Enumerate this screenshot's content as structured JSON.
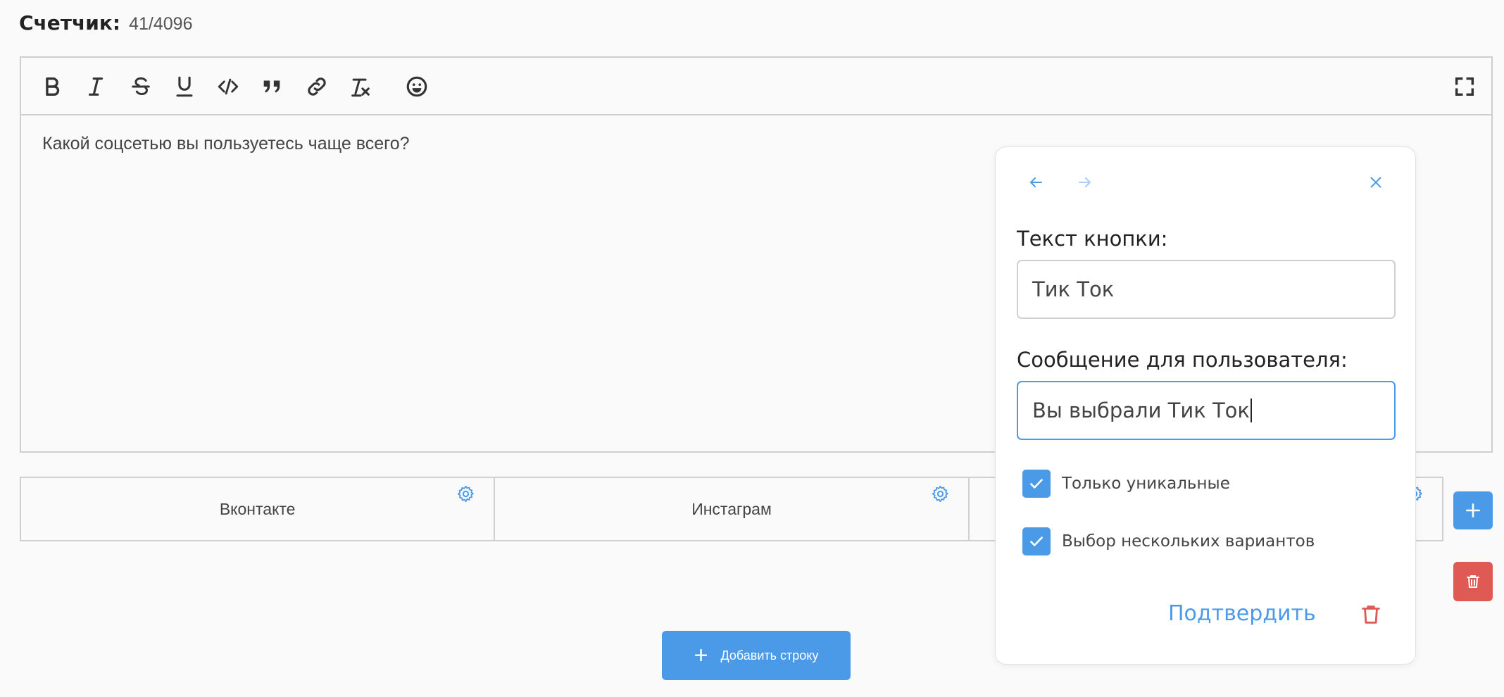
{
  "counter": {
    "label": "Счетчик:",
    "value": "41/4096"
  },
  "toolbar": {
    "icons": [
      "bold-icon",
      "italic-icon",
      "strikethrough-icon",
      "underline-icon",
      "code-icon",
      "quote-icon",
      "link-icon",
      "clear-format-icon",
      "emoji-icon",
      "fullscreen-icon"
    ]
  },
  "editor": {
    "text": "Какой соцсетью вы пользуетесь чаще всего?"
  },
  "buttons_row": {
    "items": [
      {
        "label": "Вконтакте"
      },
      {
        "label": "Инстаграм"
      },
      {
        "label": ""
      }
    ]
  },
  "add_row": {
    "label": "Добавить строку"
  },
  "popup": {
    "button_text_label": "Текст кнопки:",
    "button_text_value": "Тик Ток",
    "message_label": "Сообщение для пользователя:",
    "message_value": "Вы выбрали Тик Ток",
    "checkboxes": [
      {
        "label": "Только уникальные",
        "checked": true
      },
      {
        "label": "Выбор нескольких вариантов",
        "checked": true
      }
    ],
    "confirm_label": "Подтвердить"
  },
  "colors": {
    "accent": "#4a9ae8",
    "danger": "#e05a55",
    "border": "#cfcfcf"
  }
}
